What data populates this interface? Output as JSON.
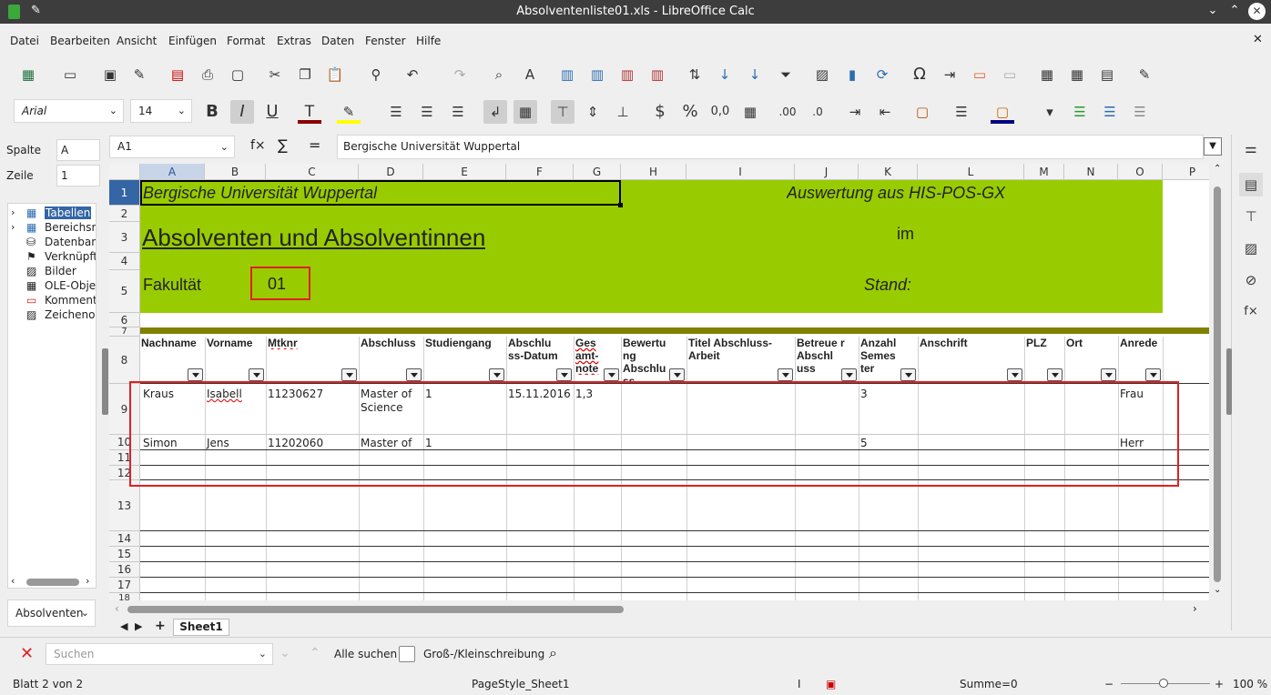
{
  "window": {
    "title": "Absolventenliste01.xls - LibreOffice Calc"
  },
  "menu": [
    "Datei",
    "Bearbeiten",
    "Ansicht",
    "Einfügen",
    "Format",
    "Extras",
    "Daten",
    "Fenster",
    "Hilfe"
  ],
  "toolbar": {
    "font_name": "Arial",
    "font_size": "14"
  },
  "formula": {
    "cell_ref": "A1",
    "content": "Bergische Universität Wuppertal"
  },
  "navigator": {
    "col_label": "Spalte",
    "col_value": "A",
    "row_label": "Zeile",
    "row_value": "1",
    "items": [
      "Tabellen",
      "Bereichsna",
      "Datenbanl",
      "Verknüpfte",
      "Bilder",
      "OLE-Objekt",
      "Kommenta",
      "Zeichenob"
    ],
    "doc_select": "Absolventen"
  },
  "columns": [
    "A",
    "B",
    "C",
    "D",
    "E",
    "F",
    "G",
    "H",
    "I",
    "J",
    "K",
    "L",
    "M",
    "N",
    "O",
    "P"
  ],
  "rows": [
    "1",
    "2",
    "3",
    "4",
    "5",
    "6",
    "7",
    "8",
    "9",
    "10",
    "11",
    "12",
    "13",
    "14",
    "15",
    "16",
    "17",
    "18"
  ],
  "sheet": {
    "title1": "Bergische Universität Wuppertal",
    "title2": "Auswertung aus HIS-POS-GX",
    "title3": "Absolventen und Absolventinnen",
    "im": "im",
    "fakultaet_label": "Fakultät",
    "fakultaet_value": "01",
    "stand": "Stand:",
    "headers": [
      "Nachname",
      "Vorname",
      "Mtknr",
      "Abschluss",
      "Studiengang",
      "Abschlu ss-Datum",
      "Ges amt-note",
      "Bewertu ng Abschlu ss",
      "Titel Abschluss-Arbeit",
      "Betreue r Abschl uss",
      "Anzahl Semes ter",
      "Anschrift",
      "PLZ",
      "Ort",
      "Anrede"
    ],
    "records": [
      {
        "nachname": "Kraus",
        "vorname": "Isabell",
        "mtknr": "11230627",
        "abschluss": "Master of Science",
        "studiengang": "1",
        "datum": "15.11.2016",
        "note": "1,3",
        "semester": "3",
        "anrede": "Frau"
      },
      {
        "nachname": "Simon",
        "vorname": "Jens",
        "mtknr": "11202060",
        "abschluss": "Master of",
        "studiengang": "1",
        "datum": "",
        "note": "",
        "semester": "5",
        "anrede": "Herr"
      }
    ]
  },
  "tabs": {
    "sheet_name": "Sheet1"
  },
  "find": {
    "placeholder": "Suchen",
    "find_all": "Alle suchen",
    "match_case": "Groß-/Kleinschreibung"
  },
  "status": {
    "sheet": "Blatt 2 von 2",
    "pagestyle": "PageStyle_Sheet1",
    "sum": "Summe=0",
    "zoom": "100 %"
  },
  "colors": {
    "green_band": "#99cc00",
    "olive_bar": "#808000",
    "highlight_red": "#e02020",
    "title_bar": "#3d3d3d"
  }
}
